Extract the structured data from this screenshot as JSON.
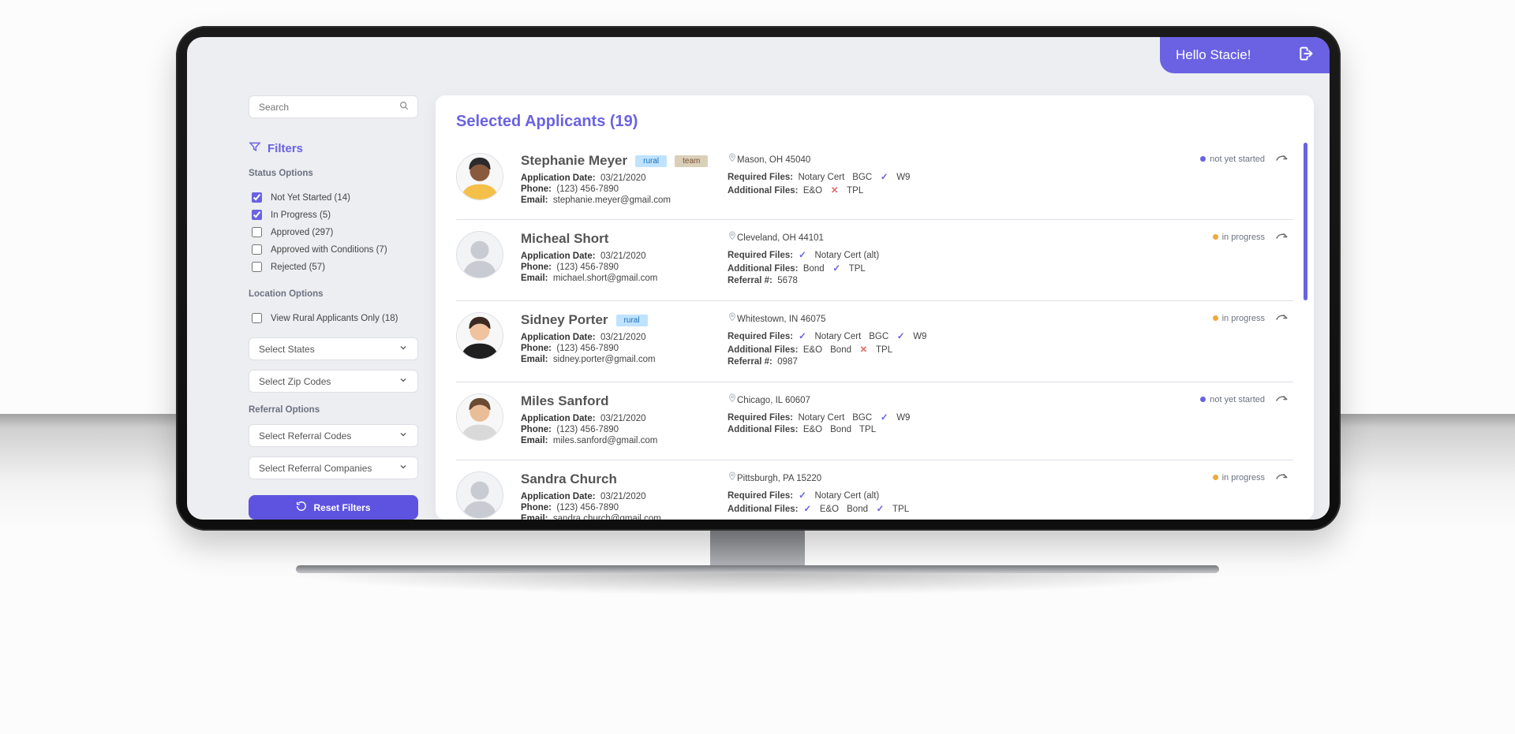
{
  "header": {
    "greeting": "Hello Stacie!"
  },
  "search": {
    "placeholder": "Search"
  },
  "filters": {
    "title": "Filters",
    "statusTitle": "Status Options",
    "status": [
      {
        "label": "Not Yet Started (14)",
        "checked": true
      },
      {
        "label": "In Progress (5)",
        "checked": true
      },
      {
        "label": "Approved (297)",
        "checked": false
      },
      {
        "label": "Approved with Conditions (7)",
        "checked": false
      },
      {
        "label": "Rejected (57)",
        "checked": false
      }
    ],
    "locationTitle": "Location Options",
    "ruralOnly": {
      "label": "View Rural Applicants Only (18)",
      "checked": false
    },
    "selectStates": "Select States",
    "selectZip": "Select Zip Codes",
    "referralTitle": "Referral Options",
    "selectReferralCodes": "Select Referral Codes",
    "selectReferralCompanies": "Select Referral Companies",
    "reset": "Reset Filters"
  },
  "labels": {
    "appDate": "Application Date:",
    "phone": "Phone:",
    "email": "Email:",
    "required": "Required Files:",
    "additional": "Additional Files:",
    "referralNum": "Referral #:"
  },
  "colors": {
    "notStarted": "#6a62e2",
    "inProgress": "#f0a83c"
  },
  "main": {
    "title": "Selected Applicants (19)"
  },
  "cards": [
    {
      "name": "Stephanie Meyer",
      "tags": [
        "rural",
        "team"
      ],
      "location": "Mason, OH 45040",
      "status": {
        "text": "not yet started",
        "color": "#6a62e2"
      },
      "date": "03/21/2020",
      "phone": "(123) 456-7890",
      "email": "stephanie.meyer@gmail.com",
      "required": [
        {
          "t": "Notary Cert"
        },
        {
          "t": "BGC"
        },
        {
          "t": "W9",
          "s": "check"
        }
      ],
      "additional": [
        {
          "t": "E&O"
        },
        {
          "t": "TPL",
          "s": "cross"
        }
      ],
      "avatar": {
        "skin": "#8a5a3e",
        "hair": "#2b2b2b",
        "shirt": "#f4c04a"
      }
    },
    {
      "name": "Micheal Short",
      "tags": [],
      "location": "Cleveland, OH 44101",
      "status": {
        "text": "in progress",
        "color": "#f0a83c"
      },
      "date": "03/21/2020",
      "phone": "(123) 456-7890",
      "email": "michael.short@gmail.com",
      "required": [
        {
          "t": "Notary Cert (alt)",
          "s": "check"
        }
      ],
      "additional": [
        {
          "t": "Bond"
        },
        {
          "t": "TPL",
          "s": "check"
        }
      ],
      "referral": "5678",
      "avatar": null
    },
    {
      "name": "Sidney Porter",
      "tags": [
        "rural"
      ],
      "location": "Whitestown, IN 46075",
      "status": {
        "text": "in progress",
        "color": "#f0a83c"
      },
      "date": "03/21/2020",
      "phone": "(123) 456-7890",
      "email": "sidney.porter@gmail.com",
      "required": [
        {
          "t": "Notary Cert",
          "s": "check"
        },
        {
          "t": "BGC"
        },
        {
          "t": "W9",
          "s": "check"
        }
      ],
      "additional": [
        {
          "t": "E&O"
        },
        {
          "t": "Bond"
        },
        {
          "t": "TPL",
          "s": "cross"
        }
      ],
      "referral": "0987",
      "avatar": {
        "skin": "#f0c29e",
        "hair": "#3b2a23",
        "shirt": "#1f1f1f"
      }
    },
    {
      "name": "Miles Sanford",
      "tags": [],
      "location": "Chicago, IL 60607",
      "status": {
        "text": "not yet started",
        "color": "#6a62e2"
      },
      "date": "03/21/2020",
      "phone": "(123) 456-7890",
      "email": "miles.sanford@gmail.com",
      "required": [
        {
          "t": "Notary Cert"
        },
        {
          "t": "BGC"
        },
        {
          "t": "W9",
          "s": "check"
        }
      ],
      "additional": [
        {
          "t": "E&O"
        },
        {
          "t": "Bond"
        },
        {
          "t": "TPL"
        }
      ],
      "avatar": {
        "skin": "#e9bd97",
        "hair": "#6a4a32",
        "shirt": "#d9d9d9"
      }
    },
    {
      "name": "Sandra Church",
      "tags": [],
      "location": "Pittsburgh, PA 15220",
      "status": {
        "text": "in progress",
        "color": "#f0a83c"
      },
      "date": "03/21/2020",
      "phone": "(123) 456-7890",
      "email": "sandra.church@gmail.com",
      "required": [
        {
          "t": "Notary Cert (alt)",
          "s": "check"
        }
      ],
      "additional": [
        {
          "t": "E&O",
          "s": "check"
        },
        {
          "t": "Bond"
        },
        {
          "t": "TPL",
          "s": "check"
        }
      ],
      "avatar": null
    }
  ]
}
